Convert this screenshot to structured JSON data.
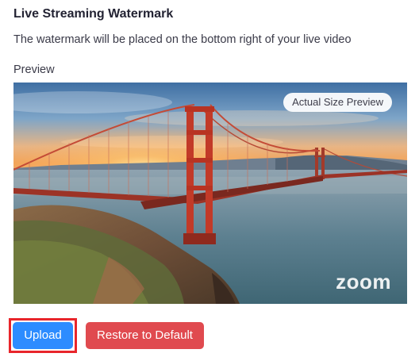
{
  "header": {
    "title": "Live Streaming Watermark",
    "description": "The watermark will be placed on the bottom right of your live video"
  },
  "preview": {
    "label": "Preview",
    "actual_size_label": "Actual Size Preview",
    "watermark_text": "zoom"
  },
  "actions": {
    "upload_label": "Upload",
    "restore_label": "Restore to Default"
  },
  "colors": {
    "upload_button": "#2d8cff",
    "restore_button": "#e04a4f",
    "highlight": "#e8252b"
  }
}
